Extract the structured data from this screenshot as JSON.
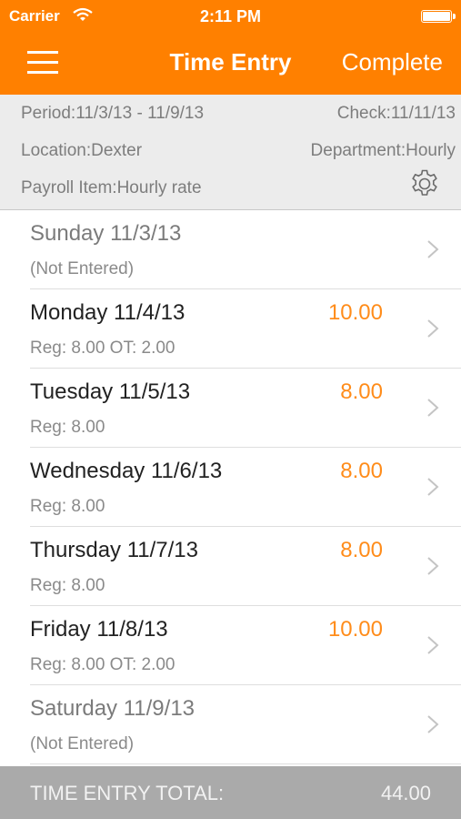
{
  "status_bar": {
    "carrier": "Carrier",
    "time": "2:11 PM",
    "wifi_icon": "wifi-icon",
    "battery_icon": "battery-icon"
  },
  "nav": {
    "title": "Time Entry",
    "action": "Complete",
    "menu_icon": "hamburger-menu-icon"
  },
  "info": {
    "period": "Period:11/3/13 - 11/9/13",
    "check": "Check:11/11/13",
    "location": "Location:Dexter",
    "department": "Department:Hourly",
    "payroll_item": "Payroll Item:Hourly rate",
    "settings_icon": "gear-icon"
  },
  "days": [
    {
      "day": "Sunday 11/3/13",
      "detail": "(Not Entered)",
      "hours": ""
    },
    {
      "day": "Monday 11/4/13",
      "detail": "Reg: 8.00 OT: 2.00",
      "hours": "10.00"
    },
    {
      "day": "Tuesday 11/5/13",
      "detail": "Reg: 8.00",
      "hours": "8.00"
    },
    {
      "day": "Wednesday 11/6/13",
      "detail": "Reg: 8.00",
      "hours": "8.00"
    },
    {
      "day": "Thursday 11/7/13",
      "detail": "Reg: 8.00",
      "hours": "8.00"
    },
    {
      "day": "Friday 11/8/13",
      "detail": "Reg: 8.00 OT: 2.00",
      "hours": "10.00"
    },
    {
      "day": "Saturday 11/9/13",
      "detail": "(Not Entered)",
      "hours": ""
    }
  ],
  "footer": {
    "label": "TIME ENTRY TOTAL:",
    "total": "44.00"
  },
  "colors": {
    "accent": "#ff8000",
    "hours": "#ff8c1a",
    "footer_bg": "#aaaaaa"
  }
}
